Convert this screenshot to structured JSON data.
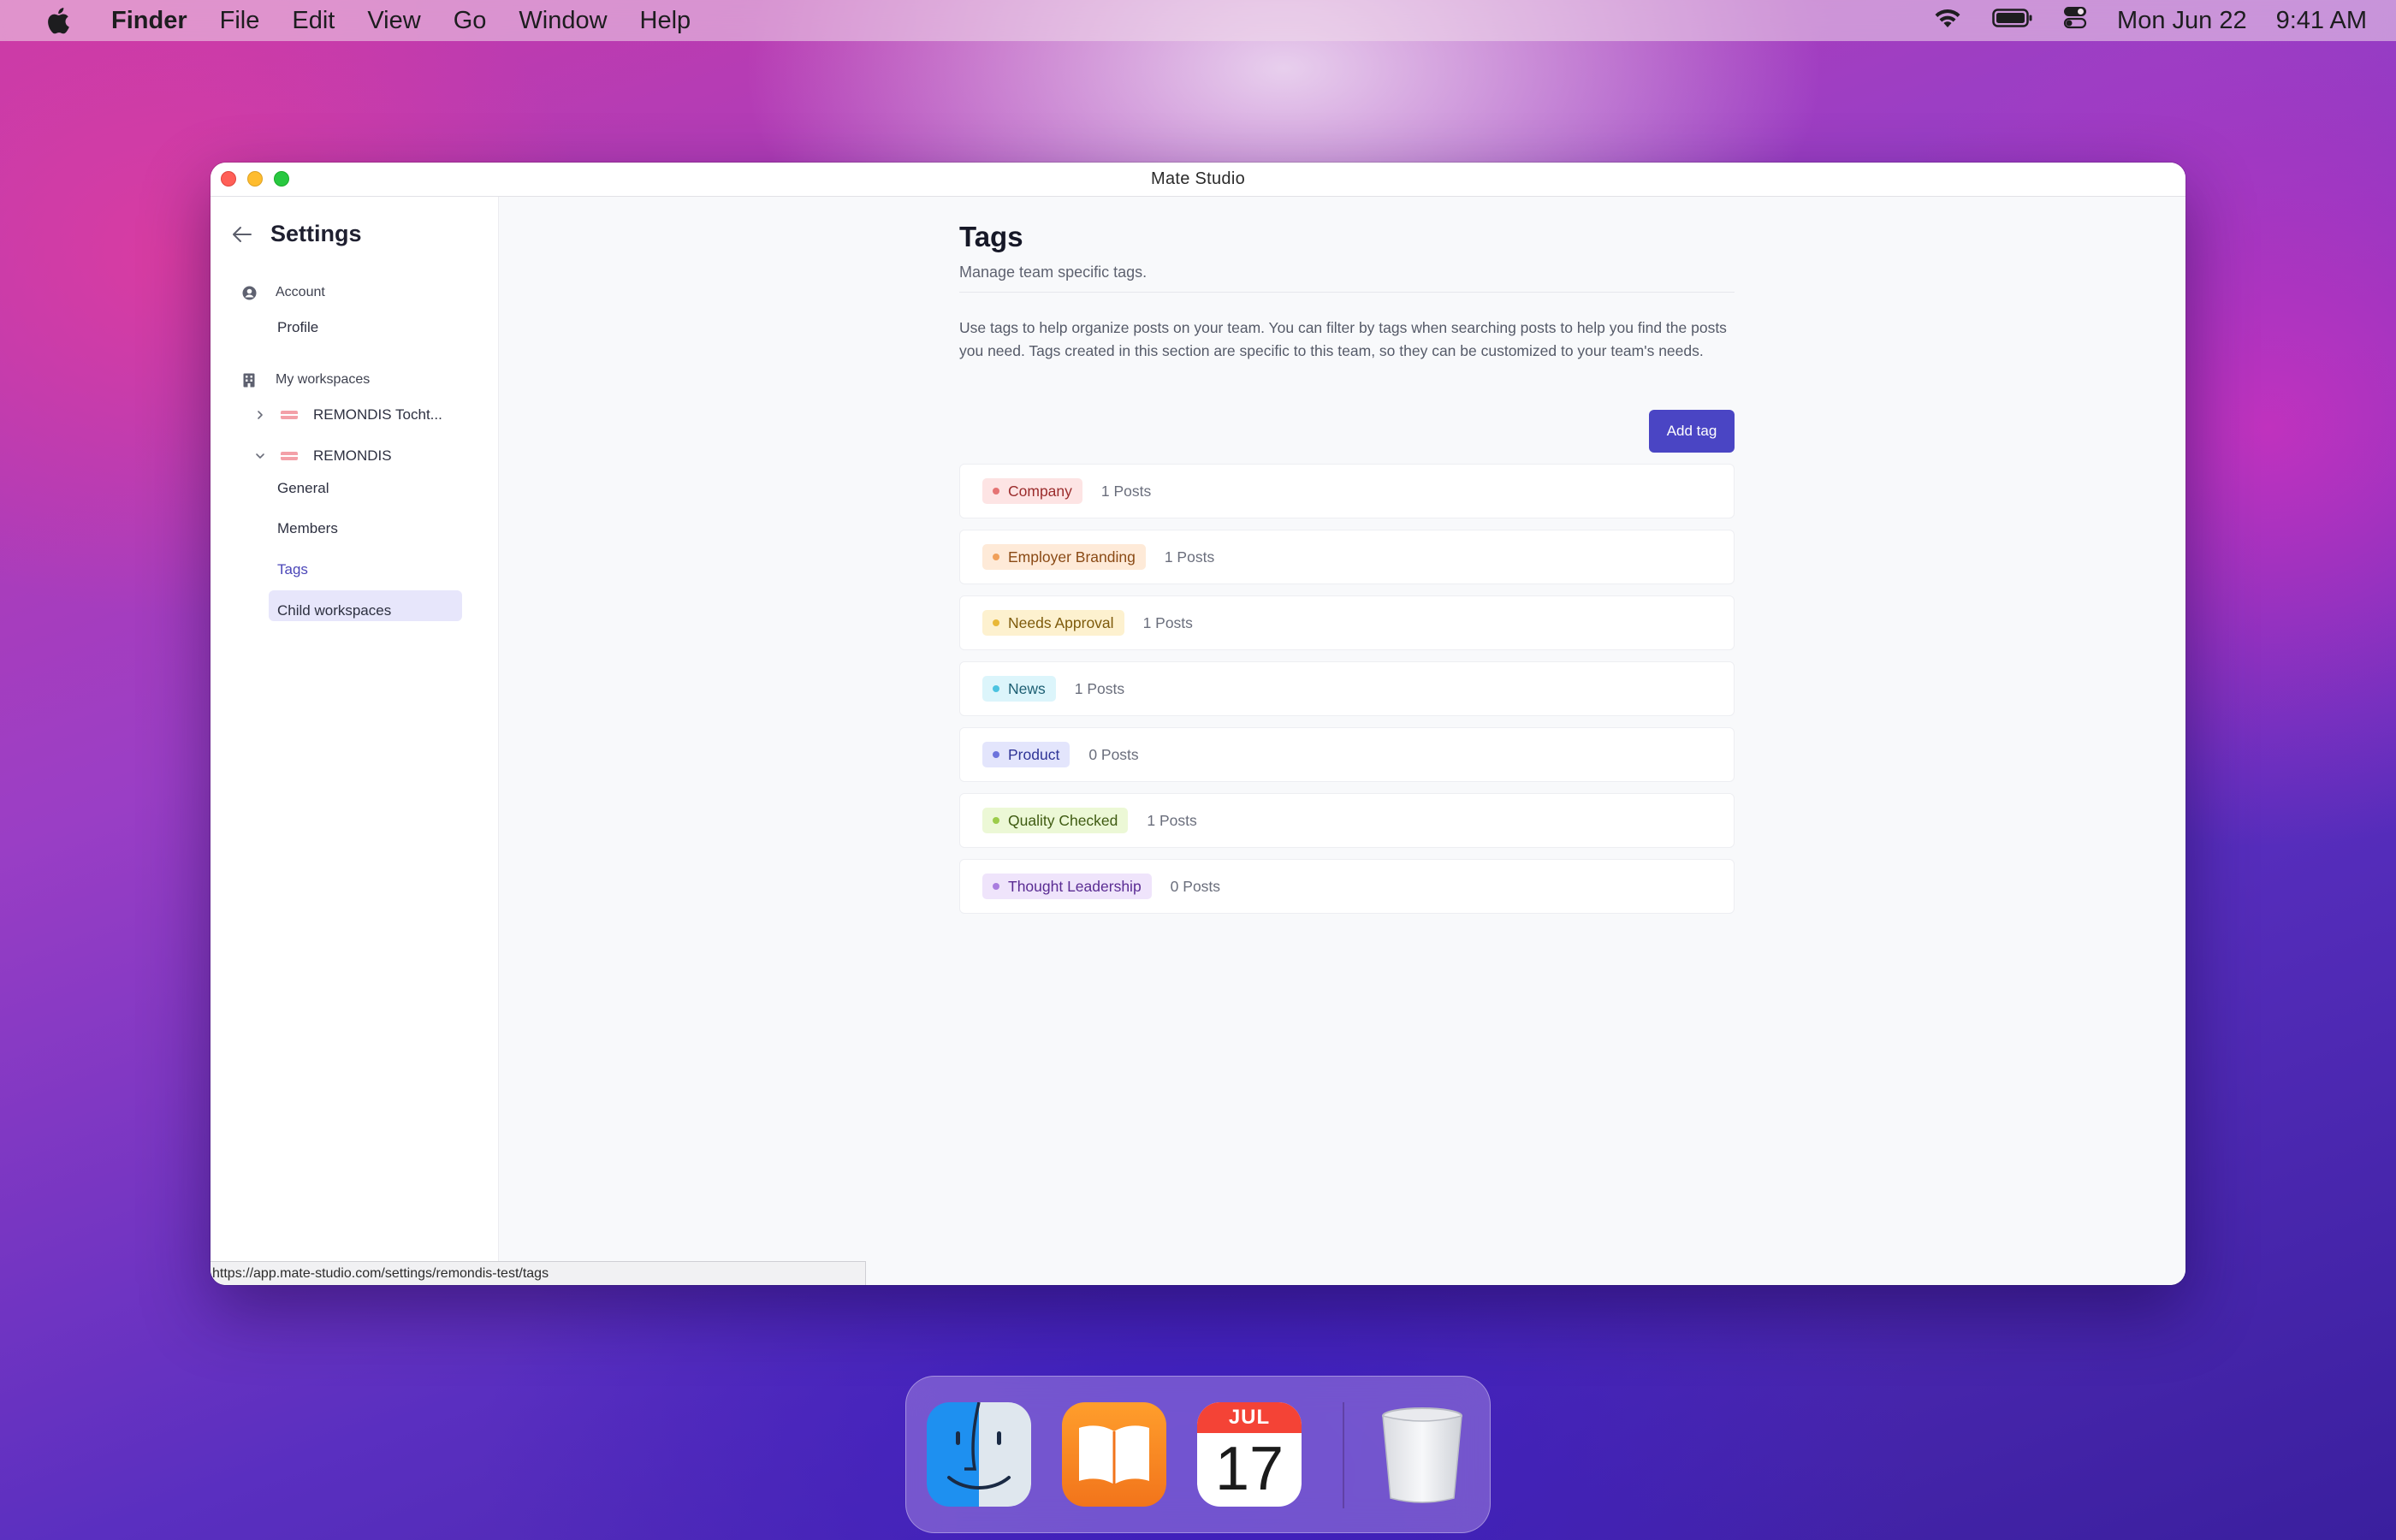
{
  "menubar": {
    "app": "Finder",
    "items": [
      "File",
      "Edit",
      "View",
      "Go",
      "Window",
      "Help"
    ],
    "date": "Mon Jun 22",
    "time": "9:41 AM"
  },
  "window": {
    "title": "Mate Studio"
  },
  "sidebar": {
    "title": "Settings",
    "account_section": "Account",
    "profile": "Profile",
    "workspaces_section": "My workspaces",
    "workspaces": [
      {
        "name": "REMONDIS Tocht...",
        "expanded": false
      },
      {
        "name": "REMONDIS",
        "expanded": true
      }
    ],
    "sub_items": [
      "General",
      "Members",
      "Tags",
      "Child workspaces"
    ],
    "active": "Tags"
  },
  "main": {
    "title": "Tags",
    "subtitle": "Manage team specific tags.",
    "description": "Use tags to help organize posts on your team. You can filter by tags when searching posts to help you find the posts you need. Tags created in this section are specific to this team, so they can be customized to your team's needs.",
    "add_button": "Add tag",
    "tags": [
      {
        "name": "Company",
        "count": "1 Posts",
        "bg": "#fde4e4",
        "fg": "#9b2c2c",
        "dot": "#e57373"
      },
      {
        "name": "Employer Branding",
        "count": "1 Posts",
        "bg": "#feead8",
        "fg": "#8a4a15",
        "dot": "#f0a05a"
      },
      {
        "name": "Needs Approval",
        "count": "1 Posts",
        "bg": "#fdf1cf",
        "fg": "#7d5a0b",
        "dot": "#e8b838"
      },
      {
        "name": "News",
        "count": "1 Posts",
        "bg": "#dcf5fb",
        "fg": "#1d5f73",
        "dot": "#4cc3e0"
      },
      {
        "name": "Product",
        "count": "0 Posts",
        "bg": "#e3e5fc",
        "fg": "#2f3496",
        "dot": "#6c73dc"
      },
      {
        "name": "Quality Checked",
        "count": "1 Posts",
        "bg": "#ecf8d6",
        "fg": "#3f5b12",
        "dot": "#9ccc4a"
      },
      {
        "name": "Thought Leadership",
        "count": "0 Posts",
        "bg": "#efe4fb",
        "fg": "#5a2c93",
        "dot": "#a97ddf"
      }
    ]
  },
  "statusbar": {
    "url": "https://app.mate-studio.com/settings/remondis-test/tags"
  },
  "dock": {
    "calendar_month": "JUL",
    "calendar_day": "17",
    "apps": [
      "finder-icon",
      "books-icon",
      "calendar-icon",
      "trash-icon"
    ]
  }
}
